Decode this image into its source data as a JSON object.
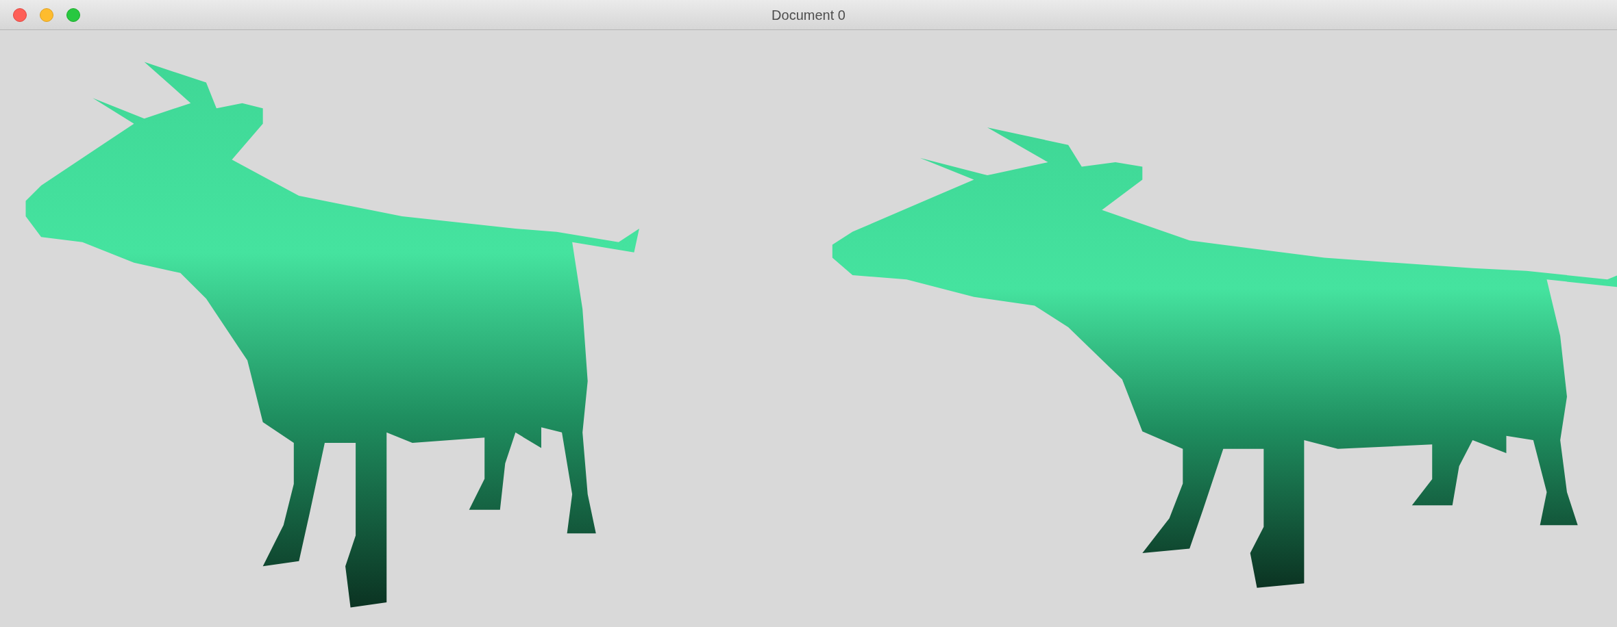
{
  "window": {
    "title": "Document 0"
  }
}
